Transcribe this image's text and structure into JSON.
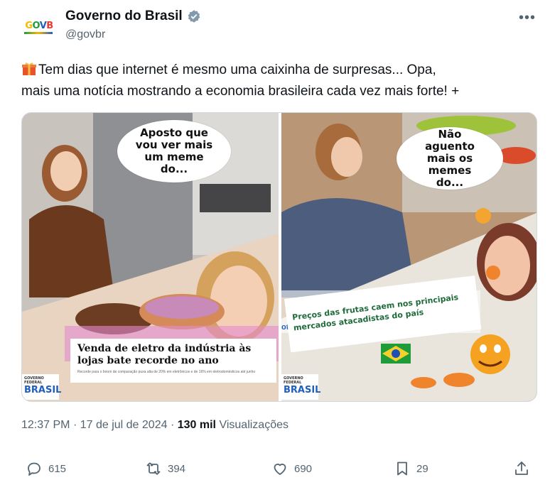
{
  "account": {
    "display_name": "Governo do Brasil",
    "handle": "@govbr",
    "avatar_letters": [
      "G",
      "O",
      "V",
      "B"
    ]
  },
  "tweet": {
    "text_line1": "Tem dias que internet é mesmo uma caixinha de surpresas... Opa,",
    "text_line2": "mais uma notícia mostrando a economia brasileira cada vez mais forte! +"
  },
  "media": {
    "left": {
      "bubble": "Aposto que vou ver mais um meme do...",
      "headline": "Venda de eletro da indústria às lojas bate recorde no ano",
      "subtext": "Recorde para o boom de comparação puxa alta de 20% em eletrônicos e de 16% em eletrodomésticos até junho",
      "logo_top": "GOVERNO FEDERAL",
      "logo_main": "BRASIL"
    },
    "right": {
      "bubble": "Não aguento mais os memes do...",
      "site_label": "otícias",
      "headline": "Preços das frutas caem nos principais mercados atacadistas do país",
      "logo_top": "GOVERNO FEDERAL",
      "logo_main": "BRASIL"
    }
  },
  "meta": {
    "time": "12:37 PM",
    "sep": "·",
    "date": "17 de jul de 2024",
    "views_count": "130 mil",
    "views_label": "Visualizações"
  },
  "actions": {
    "replies": "615",
    "retweets": "394",
    "likes": "690",
    "bookmarks": "29"
  },
  "colors": {
    "text": "#0f1419",
    "muted": "#536471",
    "verified": "#829aab"
  }
}
